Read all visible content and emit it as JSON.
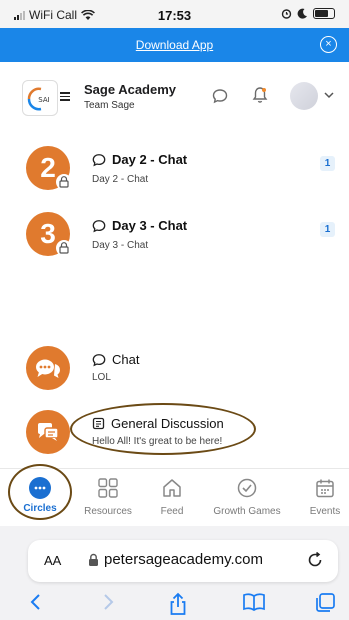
{
  "status_bar": {
    "carrier": "WiFi Call",
    "time": "17:53"
  },
  "banner": {
    "download_label": "Download App",
    "close_glyph": "×"
  },
  "header": {
    "logo_text": "SAI",
    "org_name": "Sage Academy",
    "team_name": "Team Sage"
  },
  "chats": [
    {
      "number": "2",
      "title": "Day 2 - Chat",
      "subtitle": "Day 2 - Chat",
      "unread": "1",
      "locked": true
    },
    {
      "number": "3",
      "title": "Day 3 - Chat",
      "subtitle": "Day 3 - Chat",
      "unread": "1",
      "locked": true
    },
    {
      "title": "Chat",
      "subtitle": "LOL"
    },
    {
      "title": "General Discussion",
      "subtitle": "Hello All! It's great to be here!"
    }
  ],
  "bottom_nav": [
    {
      "label": "Circles",
      "icon": "circles-icon",
      "active": true
    },
    {
      "label": "Resources",
      "icon": "grid-icon"
    },
    {
      "label": "Feed",
      "icon": "home-icon"
    },
    {
      "label": "Growth Games",
      "icon": "check-circle-icon"
    },
    {
      "label": "Events",
      "icon": "calendar-icon"
    }
  ],
  "safari": {
    "aa_label": "AA",
    "url": "petersageacademy.com"
  },
  "colors": {
    "accent_blue": "#1a86e8",
    "orange": "#e07a2e",
    "annotation_brown": "#6b4a15"
  }
}
